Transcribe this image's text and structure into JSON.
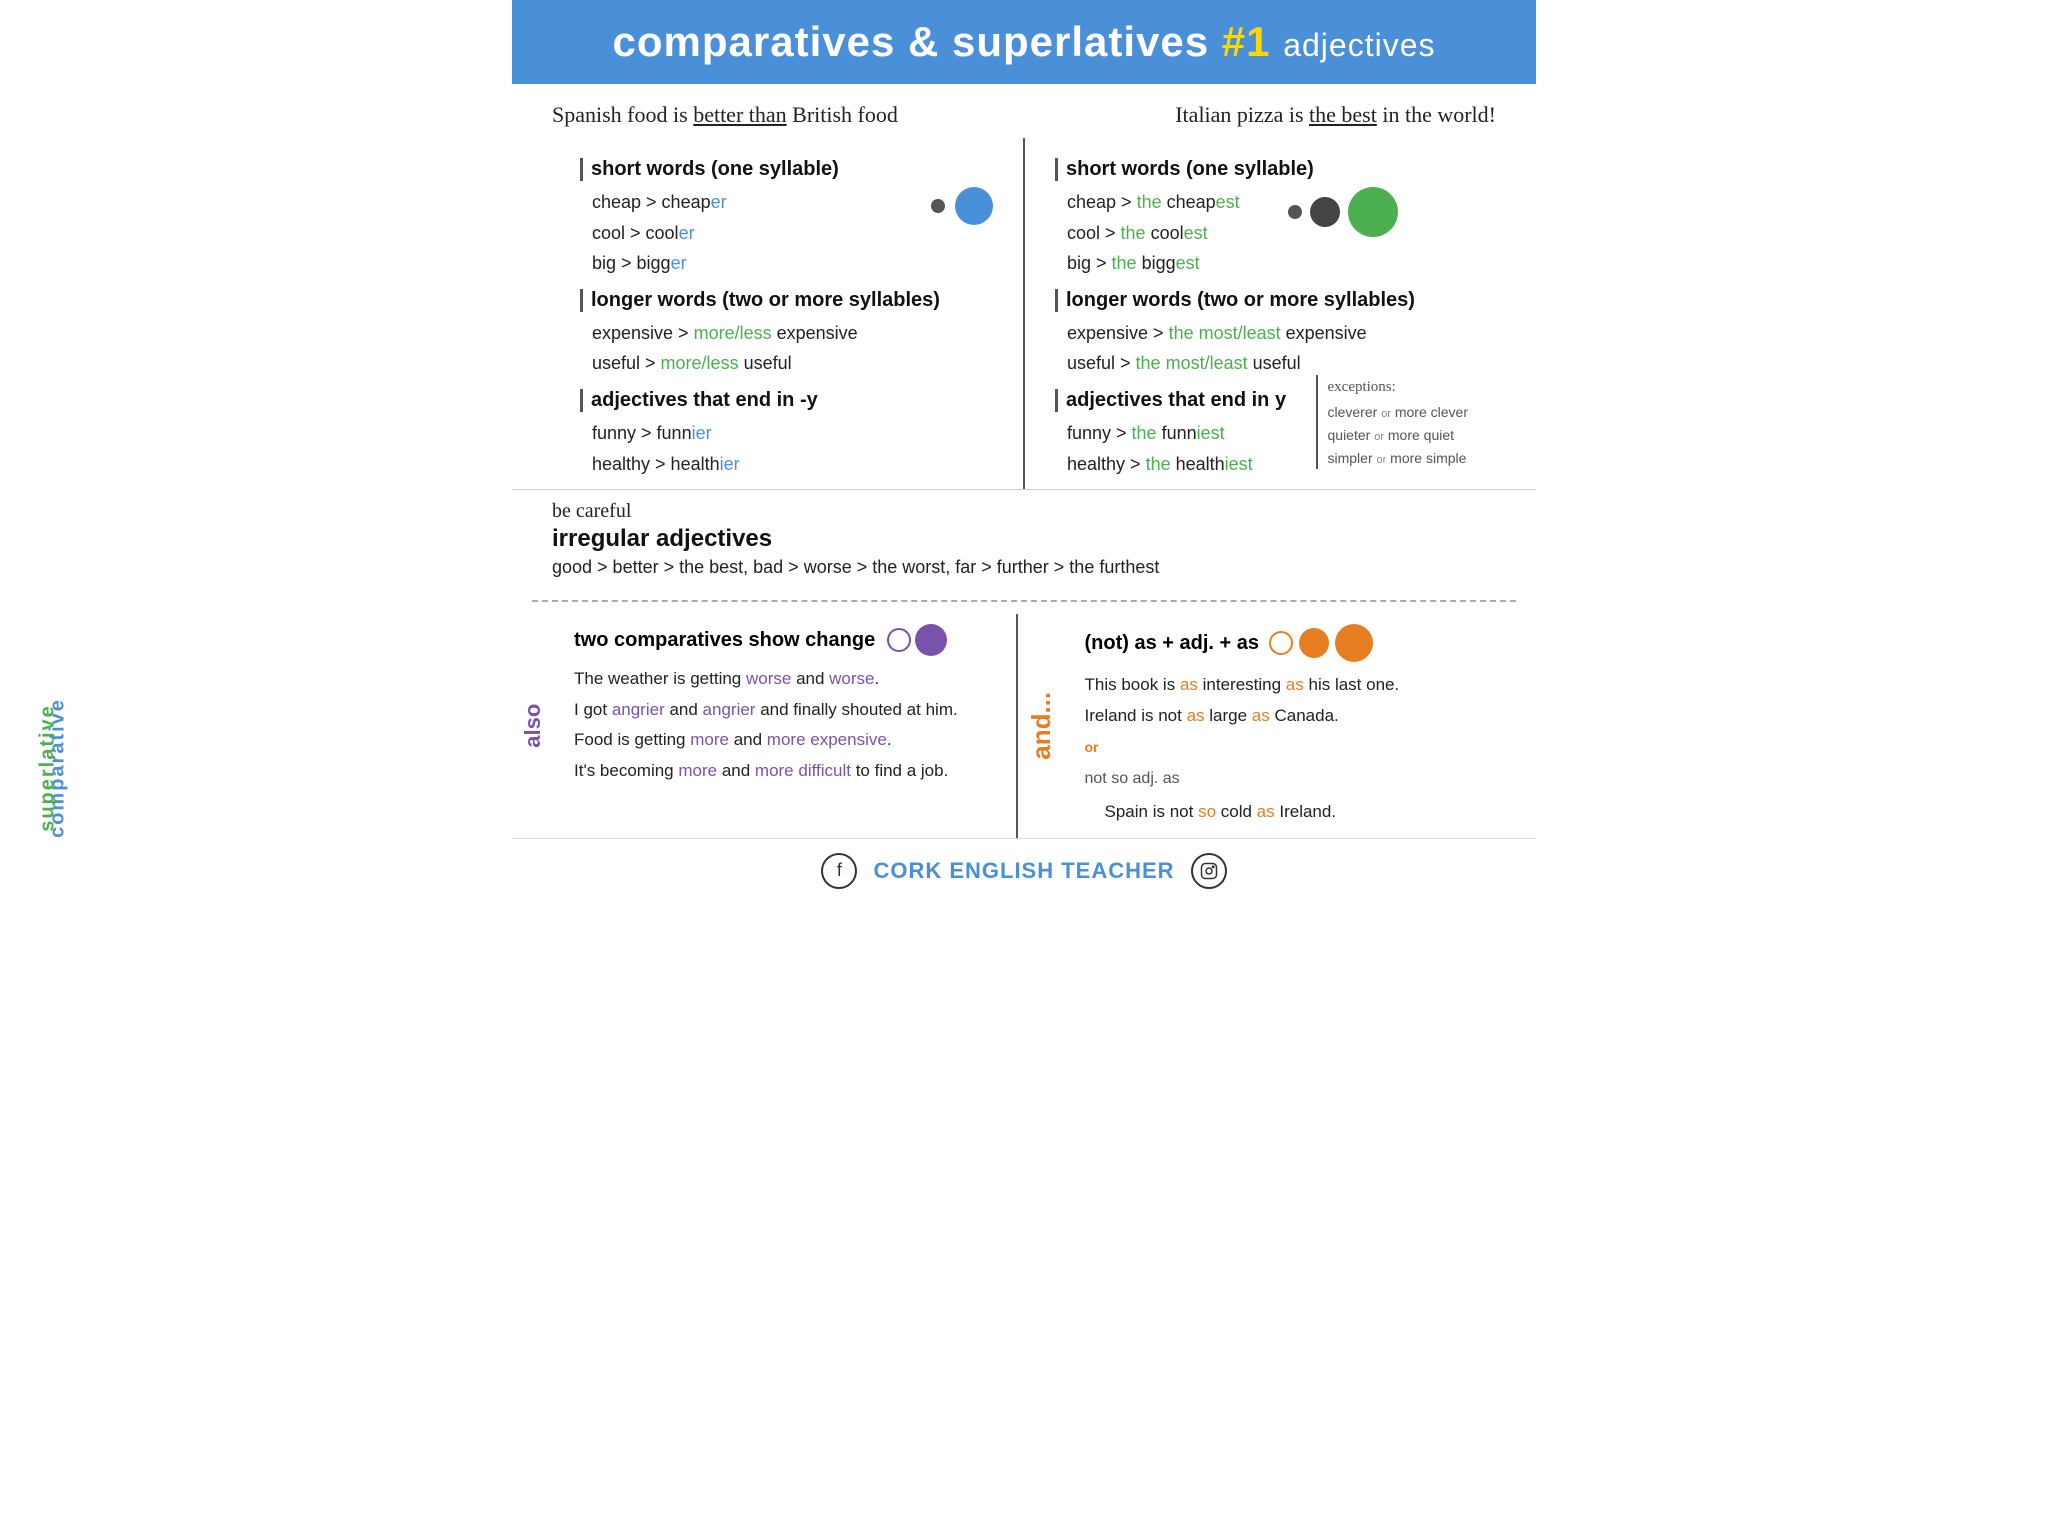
{
  "header": {
    "title": "comparatives & superlatives",
    "number": "#1",
    "subtitle": "adjectives"
  },
  "examples": {
    "left": "Spanish food is better than British food",
    "left_underline": "better than",
    "right": "Italian pizza is the best in the world!",
    "right_underline": "the best"
  },
  "comparative": {
    "label": "comparative",
    "short_words_title": "short words (one syllable)",
    "short_words": [
      {
        "base": "cheap > cheap",
        "suffix": "er"
      },
      {
        "base": "cool > cool",
        "suffix": "er"
      },
      {
        "base": "big > bigg",
        "suffix": "er"
      }
    ],
    "longer_words_title": "longer words (two or more syllables)",
    "longer_words": [
      {
        "base": "expensive > ",
        "colored": "more/less",
        "rest": " expensive"
      },
      {
        "base": "useful > ",
        "colored": "more/less",
        "rest": " useful"
      }
    ],
    "end_y_title": "adjectives that end in -y",
    "end_y_words": [
      {
        "base": "funny > funn",
        "suffix": "ier"
      },
      {
        "base": "healthy > health",
        "suffix": "ier"
      }
    ]
  },
  "superlative": {
    "label": "superlative",
    "short_words_title": "short words (one syllable)",
    "short_words": [
      {
        "base": "cheap > ",
        "the": "the",
        "word": " cheap",
        "suffix": "est"
      },
      {
        "base": "cool > ",
        "the": "the",
        "word": " cool",
        "suffix": "est"
      },
      {
        "base": "big > ",
        "the": "the",
        "word": " bigg",
        "suffix": "est"
      }
    ],
    "longer_words_title": "longer words (two or more syllables)",
    "longer_words": [
      {
        "base": "expensive > ",
        "colored": "the most/least",
        "rest": " expensive"
      },
      {
        "base": "useful > ",
        "colored": "the most/least",
        "rest": " useful"
      }
    ],
    "end_y_title": "adjectives that end in y",
    "end_y_words": [
      {
        "base": "funny > ",
        "the": "the",
        "word": " funn",
        "suffix": "iest"
      },
      {
        "base": "healthy > ",
        "the": "the",
        "word": " health",
        "suffix": "iest"
      }
    ],
    "exceptions_title": "exceptions:",
    "exceptions": [
      "cleverer or more clever",
      "quieter or more quiet",
      "simpler or more simple"
    ]
  },
  "irregular": {
    "be_careful": "be careful",
    "title": "irregular adjectives",
    "text": "good > better > the best, bad > worse > the worst, far > further > the furthest"
  },
  "also": {
    "label": "also",
    "two_comp_title": "two comparatives show change",
    "sentences": [
      {
        "pre": "The weather is getting ",
        "w1": "worse",
        "mid": " and ",
        "w2": "worse",
        "post": "."
      },
      {
        "pre": "I got ",
        "w1": "angrier",
        "mid": " and ",
        "w2": "angrier",
        "post": " and finally shouted at him."
      },
      {
        "pre": "Food is getting ",
        "w1": "more",
        "mid": " and ",
        "w2": "more expensive",
        "post": "."
      },
      {
        "pre": "It's becoming ",
        "w1": "more",
        "mid": " and ",
        "w2": "more difficult",
        "post": " to find a job."
      }
    ]
  },
  "not_as": {
    "title": "(not) as + adj. + as",
    "sentences": [
      {
        "pre": "This book is ",
        "as1": "as",
        "mid": " interesting ",
        "as2": "as",
        "post": " his last one."
      },
      {
        "pre": "Ireland is not ",
        "as1": "as",
        "mid": " large ",
        "as2": "as",
        "post": " Canada."
      }
    ],
    "or": "or",
    "not_so": "not so adj. as",
    "spain_sentence": "Spain is not so cold as Ireland.",
    "so_colored": "so",
    "as_colored": "as"
  },
  "footer": {
    "brand": "CORK ENGLISH TEACHER"
  }
}
